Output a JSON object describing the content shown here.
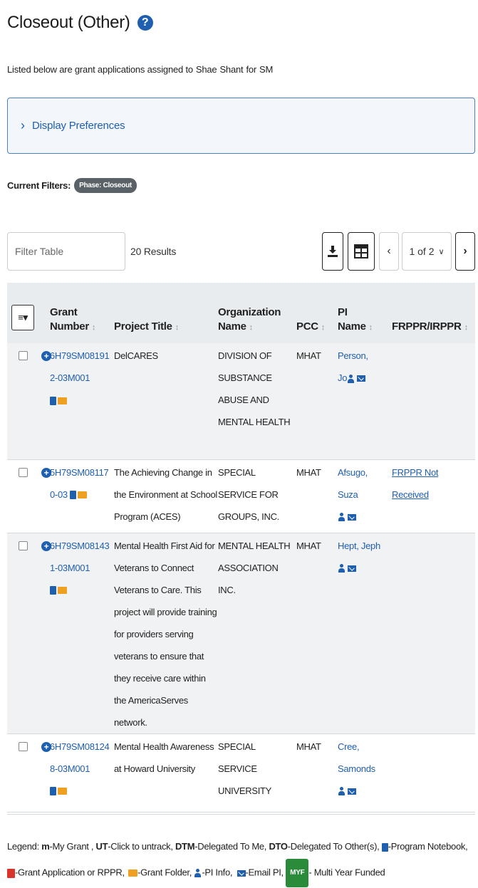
{
  "page": {
    "title": "Closeout (Other)",
    "help_icon": "question-circle-icon",
    "subtitle_prefix": "Listed below are grant applications assigned to",
    "subtitle_first": "Shae",
    "subtitle_last": "Shant",
    "subtitle_for": "for",
    "subtitle_role": "SM"
  },
  "preferences": {
    "label": "Display Preferences"
  },
  "filters": {
    "label": "Current Filters:",
    "chip": "Phase: Closeout"
  },
  "toolbar": {
    "filter_placeholder": "Filter Table",
    "results": "20 Results",
    "page_label": "1 of 2"
  },
  "table": {
    "headers": {
      "grant_line1": "Grant",
      "grant_line2": "Number",
      "project": "Project Title",
      "org_line1": "Organization",
      "org_line2": "Name",
      "pcc": "PCC",
      "pi_line1": "PI",
      "pi_line2": "Name",
      "frppr": "FRPPR/IRPPR"
    },
    "rows": [
      {
        "grant_a": "6H79SM08191",
        "grant_b": "2-03M001",
        "title": "DelCARES",
        "org": "DIVISION OF SUBSTANCE ABUSE AND MENTAL HEALTH",
        "pcc": "MHAT",
        "pi_a": "Person,",
        "pi_b": "Jo",
        "frppr": ""
      },
      {
        "grant_a": "5H79SM08117",
        "grant_b": "0-03",
        "title": "The Achieving Change in the Environment at School Program (ACES)",
        "org": "SPECIAL SERVICE FOR GROUPS, INC.",
        "pcc": "MHAT",
        "pi_a": "Afsugo,",
        "pi_b": "Suza",
        "frppr": "FRPPR Not Received"
      },
      {
        "grant_a": "6H79SM08143",
        "grant_b": "1-03M001",
        "title": "Mental Health First Aid for Veterans to Connect Veterans to Care. This project will provide training for providers serving veterans to ensure that they receive care within the AmericaServes network.",
        "org": "MENTAL HEALTH ASSOCIATION INC.",
        "pcc": "MHAT",
        "pi_a": "Hept, Jeph",
        "pi_b": "",
        "frppr": ""
      },
      {
        "grant_a": "6H79SM08124",
        "grant_b": "8-03M001",
        "title": "Mental Health Awareness at Howard University",
        "org": "SPECIAL SERVICE UNIVERSITY",
        "pcc": "MHAT",
        "pi_a": "Cree,",
        "pi_b": "Samonds",
        "frppr": ""
      }
    ]
  },
  "legend": {
    "prefix": "Legend:",
    "m_key": "m",
    "m_text": "-My Grant ,",
    "ut_key": "UT",
    "ut_text": "-Click to untrack,",
    "dtm_key": "DTM",
    "dtm_text": "-Delegated To Me,",
    "dto_key": "DTO",
    "dto_text": "-Delegated To Other(s),",
    "notebook_text": "-Program Notebook,",
    "pdf_text": "-Grant Application or RPPR,",
    "folder_text": "-Grant Folder,",
    "pi_text": "-PI Info,",
    "email_text": "-Email PI,",
    "myf_badge": "MYF",
    "myf_text": "- Multi Year Funded"
  },
  "colors": {
    "link": "#1f5fb0",
    "chip": "#5a6268",
    "myf": "#2a8c3a",
    "pdf": "#d9342b",
    "folder": "#f0a020",
    "prefs_border": "#4a7fc1"
  }
}
